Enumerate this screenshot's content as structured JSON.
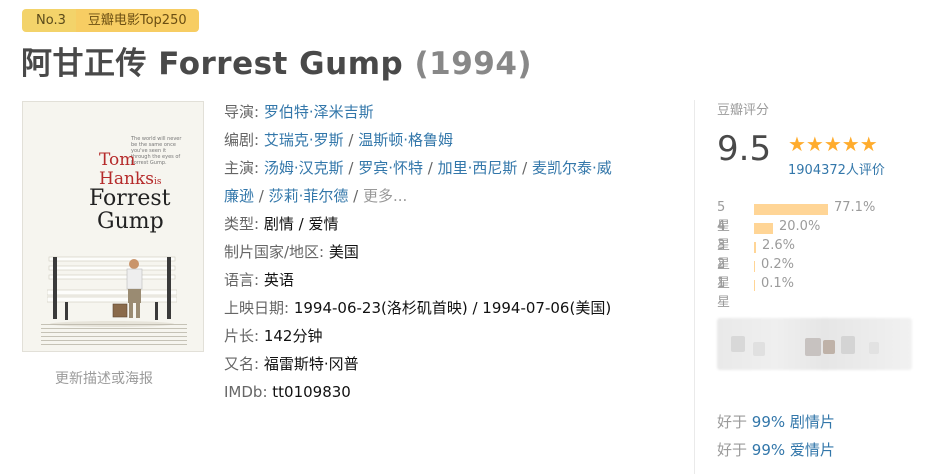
{
  "badge": {
    "rank": "No.3",
    "list_label": "豆瓣电影Top250"
  },
  "title": {
    "main": "阿甘正传 Forrest Gump",
    "year": "(1994)"
  },
  "poster": {
    "tagline": "The world will never be the same once you've seen it through the eyes of Forrest Gump.",
    "line1": "Tom",
    "line2": "Hanks",
    "line3": "is",
    "line4": "Forrest",
    "line5": "Gump",
    "update_link": "更新描述或海报"
  },
  "info": {
    "director_label": "导演: ",
    "director": "罗伯特·泽米吉斯",
    "writer_label": "编剧: ",
    "writers": [
      "艾瑞克·罗斯",
      "温斯顿·格鲁姆"
    ],
    "cast_label": "主演: ",
    "cast": [
      "汤姆·汉克斯",
      "罗宾·怀特",
      "加里·西尼斯",
      "麦凯尔泰·威廉逊",
      "莎莉·菲尔德"
    ],
    "cast_line1": [
      "汤姆·汉克斯",
      "罗宾·怀特",
      "加里·西尼斯",
      "麦凯尔泰·威"
    ],
    "cast_line2_prefix": "廉逊",
    "cast_line2_second": "莎莉·菲尔德",
    "cast_more": "更多...",
    "genre_label": "类型: ",
    "genres": [
      "剧情",
      "爱情"
    ],
    "country_label": "制片国家/地区: ",
    "country": "美国",
    "language_label": "语言: ",
    "language": "英语",
    "release_label": "上映日期: ",
    "release": "1994-06-23(洛杉矶首映) / 1994-07-06(美国)",
    "runtime_label": "片长: ",
    "runtime": "142分钟",
    "aka_label": "又名: ",
    "aka": "福雷斯特·冈普",
    "imdb_label": "IMDb: ",
    "imdb": "tt0109830"
  },
  "rating": {
    "label": "豆瓣评分",
    "score": "9.5",
    "stars": "★★★★★",
    "count": "1904372人评价",
    "distribution": [
      {
        "label": "5星",
        "percent": "77.1%",
        "value": 77.1
      },
      {
        "label": "4星",
        "percent": "20.0%",
        "value": 20.0
      },
      {
        "label": "3星",
        "percent": "2.6%",
        "value": 2.6
      },
      {
        "label": "2星",
        "percent": "0.2%",
        "value": 0.2
      },
      {
        "label": "1星",
        "percent": "0.1%",
        "value": 0.1
      }
    ]
  },
  "better_than": [
    {
      "prefix": "好于 ",
      "percent": "99%",
      "genre": "剧情片"
    },
    {
      "prefix": "好于 ",
      "percent": "99%",
      "genre": "爱情片"
    }
  ],
  "colors": {
    "link": "#3377aa",
    "star": "#ffac2d",
    "bar": "#ffd596",
    "badge": "#f7cd63"
  }
}
